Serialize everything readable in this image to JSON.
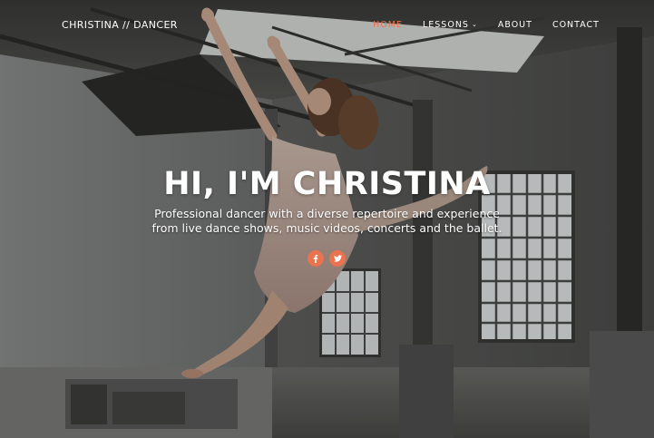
{
  "brand": "CHRISTINA // DANCER",
  "nav": {
    "items": [
      {
        "label": "HOME",
        "active": true
      },
      {
        "label": "LESSONS",
        "dropdown": true
      },
      {
        "label": "ABOUT"
      },
      {
        "label": "CONTACT"
      }
    ]
  },
  "hero": {
    "title": "HI, I'M CHRISTINA",
    "tagline": "Professional dancer with a diverse repertoire and experience from live dance shows, music videos, concerts and the ballet."
  },
  "social": {
    "icons": [
      "facebook-icon",
      "twitter-icon"
    ],
    "accent": "#e8734e"
  }
}
